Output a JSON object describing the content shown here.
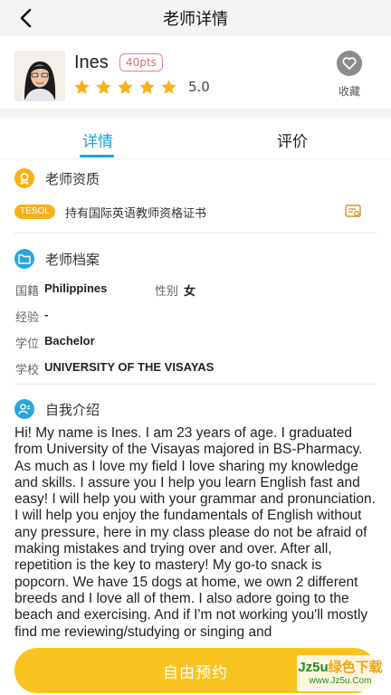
{
  "nav": {
    "title": "老师详情"
  },
  "teacher": {
    "name": "Ines",
    "points_badge": "40pts",
    "star_count": 5,
    "rating": "5.0",
    "favorite_label": "收藏"
  },
  "tabs": [
    {
      "label": "详情",
      "active": true
    },
    {
      "label": "评价",
      "active": false
    }
  ],
  "qualification": {
    "title": "老师资质",
    "badge": "TESOL",
    "text": "持有国际英语教师资格证书"
  },
  "profile": {
    "title": "老师档案",
    "nationality_label": "国籍",
    "nationality_value": "Philippines",
    "gender_label": "性别",
    "gender_value": "女",
    "experience_label": "经验",
    "experience_value": "-",
    "degree_label": "学位",
    "degree_value": "Bachelor",
    "school_label": "学校",
    "school_value": "UNIVERSITY OF THE VISAYAS"
  },
  "intro": {
    "title": "自我介绍",
    "text": "Hi! My name is Ines. I am 23 years of age. I graduated from University of the Visayas majored in BS-Pharmacy. As much as I love my field I love sharing my knowledge and skills. I assure you I help you learn English fast and easy! I will help you with your grammar and pronunciation. I will help you enjoy the fundamentals of English without any pressure, here in my class please do not be afraid of making mistakes and trying over and over. After all, repetition is the key to mastery! My go-to snack is popcorn. We have 15 dogs at home, we own 2 different breeds and I love all of them. I also adore going to the beach and exercising. And if I'm not working you'll mostly find me reviewing/studying or singing and"
  },
  "cta": {
    "label": "自由预约"
  },
  "watermark": {
    "brand": "Jz5u",
    "brand_suffix": "绿色下载",
    "url": "www.Jz5u.Com"
  },
  "colors": {
    "accent_blue": "#1aa3d6",
    "star_yellow": "#f7b21a",
    "cta_yellow": "#f9c31f",
    "badge_red": "#e06a6a"
  },
  "icons": {
    "back": "chevron-left-icon",
    "favorite": "heart-icon",
    "qualification": "award-icon",
    "profile": "folder-icon",
    "intro": "user-card-icon",
    "certificate": "certificate-icon"
  }
}
